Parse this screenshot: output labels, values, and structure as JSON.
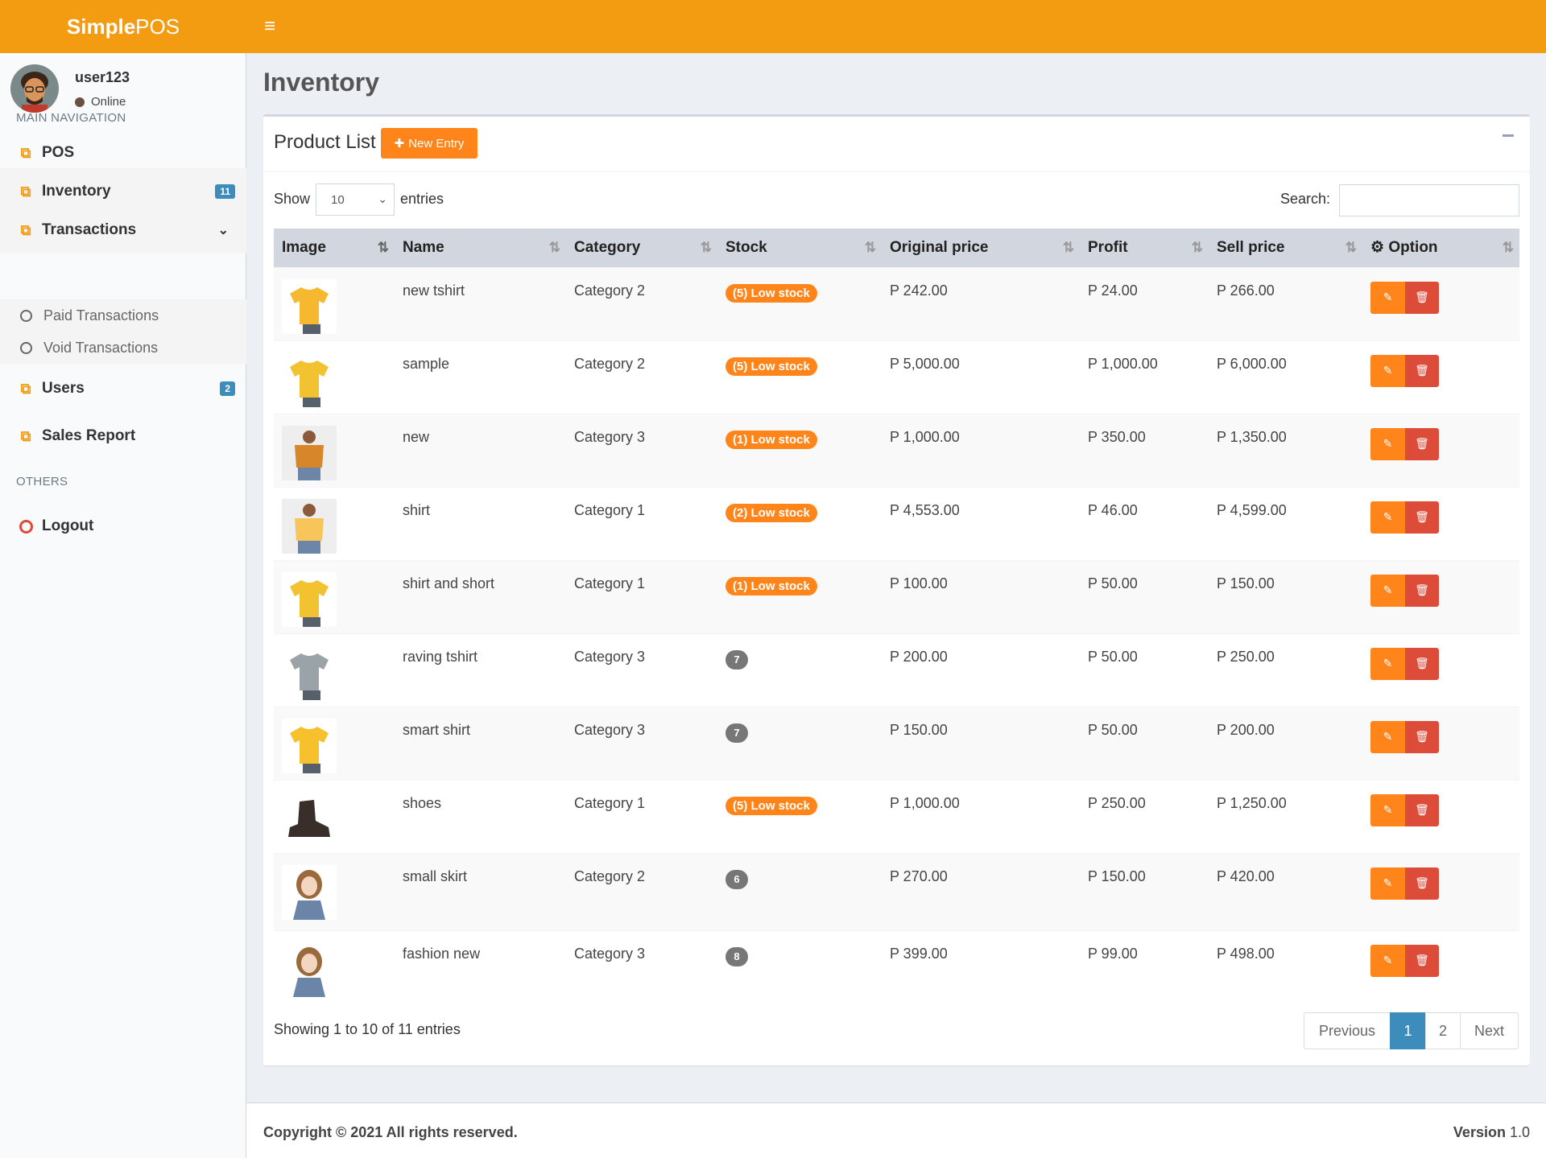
{
  "brand": {
    "bold": "Simple",
    "light": "POS"
  },
  "user": {
    "name": "user123",
    "status": "Online"
  },
  "nav": {
    "main_header": "MAIN NAVIGATION",
    "others_header": "OTHERS",
    "pos": "POS",
    "inventory": "Inventory",
    "inventory_badge": "11",
    "transactions": "Transactions",
    "paid": "Paid Transactions",
    "void": "Void Transactions",
    "users": "Users",
    "users_badge": "2",
    "sales_report": "Sales Report",
    "logout": "Logout"
  },
  "page": {
    "title": "Inventory",
    "box_title": "Product List",
    "new_entry": "New Entry",
    "show": "Show",
    "entries_value": "10",
    "entries": "entries",
    "search": "Search:",
    "info": "Showing 1 to 10 of 11 entries"
  },
  "columns": [
    "Image",
    "Name",
    "Category",
    "Stock",
    "Original price",
    "Profit",
    "Sell price",
    "Option"
  ],
  "products": [
    {
      "name": "new tshirt",
      "category": "Category 2",
      "stock": "(5) Low stock",
      "low": true,
      "original": "P 242.00",
      "profit": "P 24.00",
      "sell": "P 266.00"
    },
    {
      "name": "sample",
      "category": "Category 2",
      "stock": "(5) Low stock",
      "low": true,
      "original": "P 5,000.00",
      "profit": "P 1,000.00",
      "sell": "P 6,000.00"
    },
    {
      "name": "new",
      "category": "Category 3",
      "stock": "(1) Low stock",
      "low": true,
      "original": "P 1,000.00",
      "profit": "P 350.00",
      "sell": "P 1,350.00"
    },
    {
      "name": "shirt",
      "category": "Category 1",
      "stock": "(2) Low stock",
      "low": true,
      "original": "P 4,553.00",
      "profit": "P 46.00",
      "sell": "P 4,599.00"
    },
    {
      "name": "shirt and short",
      "category": "Category 1",
      "stock": "(1) Low stock",
      "low": true,
      "original": "P 100.00",
      "profit": "P 50.00",
      "sell": "P 150.00"
    },
    {
      "name": "raving tshirt",
      "category": "Category 3",
      "stock": "7",
      "low": false,
      "original": "P 200.00",
      "profit": "P 50.00",
      "sell": "P 250.00"
    },
    {
      "name": "smart shirt",
      "category": "Category 3",
      "stock": "7",
      "low": false,
      "original": "P 150.00",
      "profit": "P 50.00",
      "sell": "P 200.00"
    },
    {
      "name": "shoes",
      "category": "Category 1",
      "stock": "(5) Low stock",
      "low": true,
      "original": "P 1,000.00",
      "profit": "P 250.00",
      "sell": "P 1,250.00"
    },
    {
      "name": "small skirt",
      "category": "Category 2",
      "stock": "6",
      "low": false,
      "original": "P 270.00",
      "profit": "P 150.00",
      "sell": "P 420.00"
    },
    {
      "name": "fashion new",
      "category": "Category 3",
      "stock": "8",
      "low": false,
      "original": "P 399.00",
      "profit": "P 99.00",
      "sell": "P 498.00"
    }
  ],
  "pagination": {
    "previous": "Previous",
    "page1": "1",
    "page2": "2",
    "next": "Next"
  },
  "footer": {
    "copyright": "Copyright © 2021 All rights reserved.",
    "version_label": "Version",
    "version": "1.0"
  },
  "colors": {
    "header": "#f39c12",
    "accent": "#ff851b",
    "danger": "#dd4b39",
    "primary": "#3c8dbc"
  }
}
